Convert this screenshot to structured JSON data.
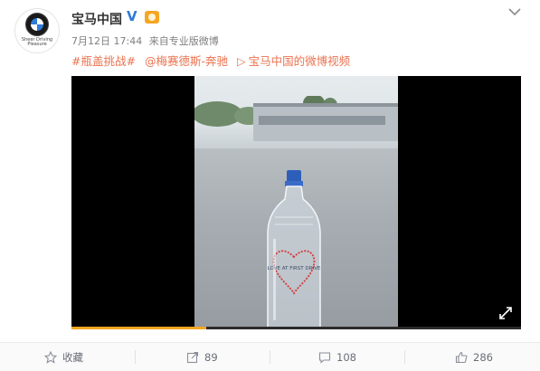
{
  "account": {
    "name": "宝马中国",
    "verified_mark": "V",
    "avatar_slogan": "Sheer Driving Pleasure"
  },
  "meta": {
    "date": "7月12日 17:44",
    "source_prefix": "来自",
    "source": "专业版微博"
  },
  "content": {
    "topic": "#瓶盖挑战#",
    "mention": "@梅赛德斯-奔驰",
    "video_link": "宝马中国的微博视频"
  },
  "video": {
    "bottle_label": "LOVE AT FIRST DRIVE",
    "progress_fraction": 0.3
  },
  "actions": {
    "favorite": "收藏",
    "repost": "89",
    "comment": "108",
    "like": "286"
  },
  "colors": {
    "link": "#eb7350",
    "verified": "#2f7bd8",
    "progress": "#f5a623"
  }
}
